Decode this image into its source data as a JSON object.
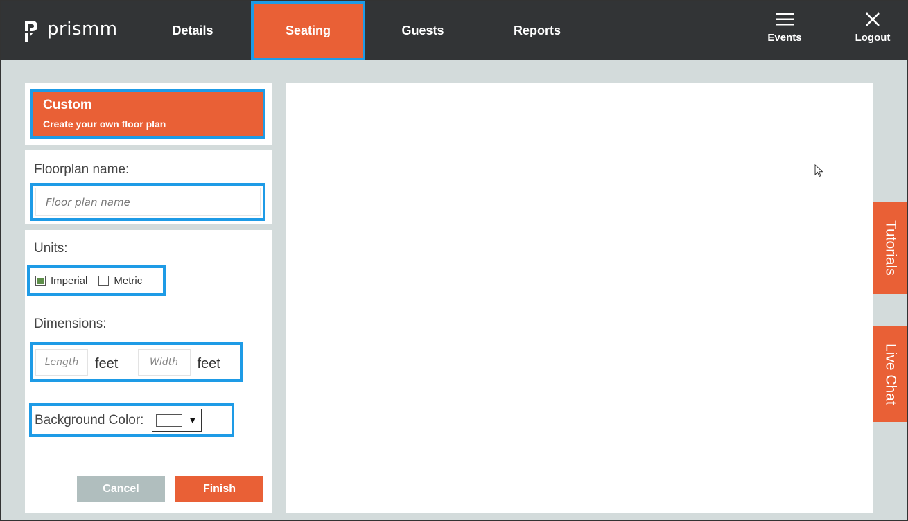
{
  "app": {
    "logo_text": "prismm"
  },
  "nav": {
    "tabs": [
      {
        "label": "Details",
        "active": false
      },
      {
        "label": "Seating",
        "active": true
      },
      {
        "label": "Guests",
        "active": false
      },
      {
        "label": "Reports",
        "active": false
      }
    ],
    "events_label": "Events",
    "logout_label": "Logout"
  },
  "panel": {
    "custom_title": "Custom",
    "custom_subtitle": "Create your own floor plan",
    "floorplan_label": "Floorplan name:",
    "floorplan_placeholder": "Floor plan name",
    "units_label": "Units:",
    "units": [
      {
        "label": "Imperial",
        "checked": true
      },
      {
        "label": "Metric",
        "checked": false
      }
    ],
    "dimensions_label": "Dimensions:",
    "length_placeholder": "Length",
    "width_placeholder": "Width",
    "length_unit": "feet",
    "width_unit": "feet",
    "bg_color_label": "Background Color:",
    "bg_color_value": "#ffffff",
    "cancel_label": "Cancel",
    "finish_label": "Finish"
  },
  "side_tabs": {
    "tutorials": "Tutorials",
    "live_chat": "Live Chat"
  },
  "colors": {
    "accent": "#e96036",
    "nav_bg": "#323436",
    "highlight": "#1e9be6",
    "page_bg": "#d3dbdb",
    "cancel_bg": "#b0bebe"
  },
  "icons": [
    "prismm-logo-icon",
    "menu-icon",
    "close-icon",
    "mouse-cursor-icon",
    "dropdown-arrow-icon"
  ]
}
